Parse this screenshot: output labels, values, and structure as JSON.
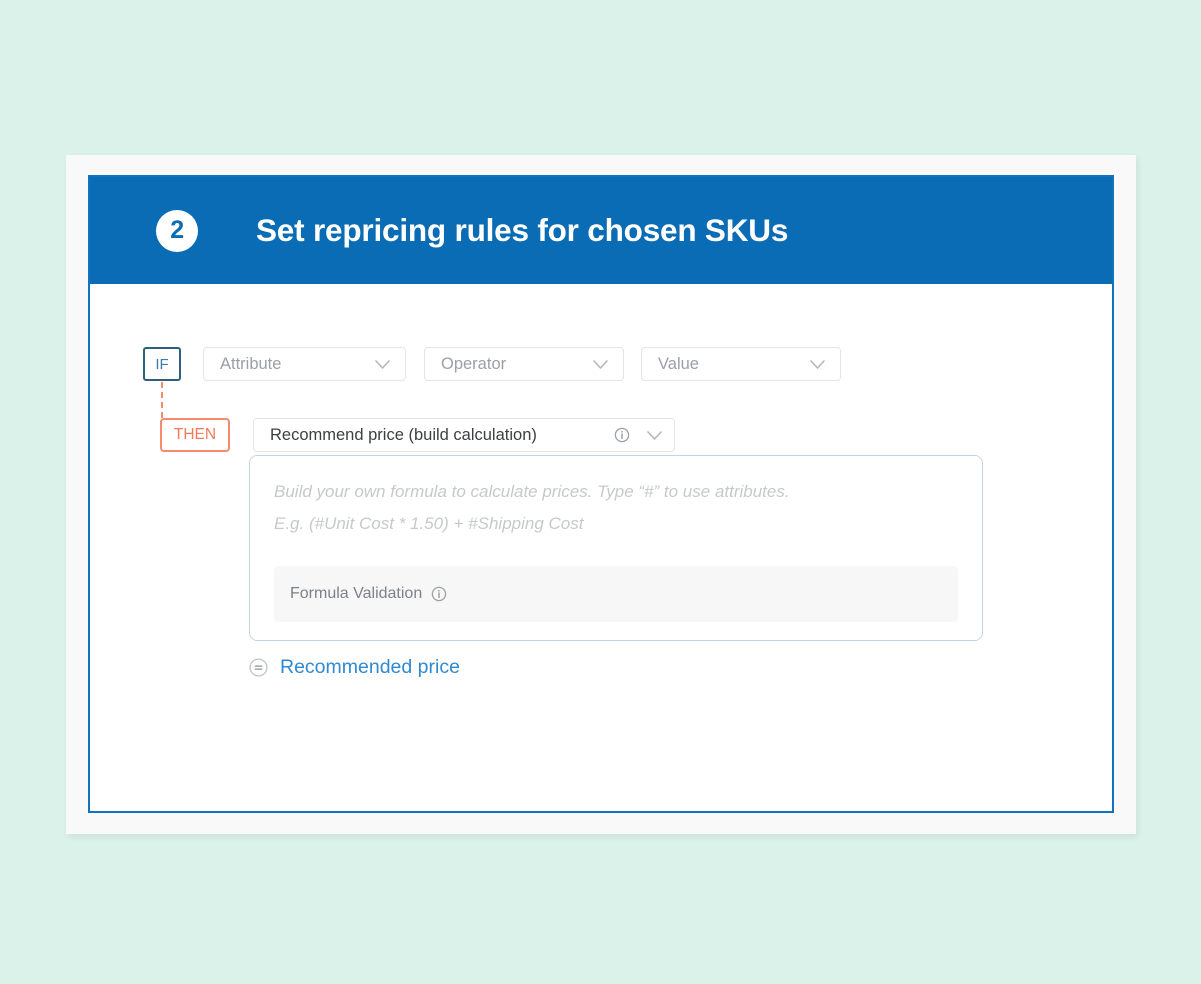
{
  "page": {
    "background_color": "#daf2ea",
    "frame_color": "#f9f9f9",
    "card_border_color": "#1372bd"
  },
  "header": {
    "step_number": "2",
    "title": "Set repricing rules for chosen SKUs",
    "background_color": "#0a6cb4",
    "text_color": "#ffffff"
  },
  "rule_builder": {
    "if_row": {
      "tag_label": "IF",
      "tag_border_color": "#2e617f",
      "tag_text_color": "#3a7faa",
      "selects": [
        {
          "placeholder": "Attribute",
          "icon": "chevron-down-icon"
        },
        {
          "placeholder": "Operator",
          "icon": "chevron-down-icon"
        },
        {
          "placeholder": "Value",
          "icon": "chevron-down-icon"
        }
      ]
    },
    "connector": {
      "style": "dashed",
      "color": "#f58a6e"
    },
    "then_row": {
      "tag_label": "THEN",
      "tag_border_color": "#f58a6e",
      "tag_text_color": "#f07a5a",
      "action_select": {
        "value": "Recommend price (build calculation)",
        "info_icon": "info-icon",
        "chevron_icon": "chevron-down-icon"
      }
    },
    "formula_box": {
      "placeholder_line_1": "Build your own formula to calculate prices. Type “#” to use attributes.",
      "placeholder_line_2": "E.g. (#Unit Cost * 1.50) + #Shipping Cost",
      "validation": {
        "label": "Formula Validation",
        "info_icon": "info-icon",
        "background_color": "#f7f7f8"
      }
    },
    "output": {
      "icon": "equals-circle-icon",
      "label": "Recommended price",
      "text_color": "#2f8ad1"
    }
  }
}
